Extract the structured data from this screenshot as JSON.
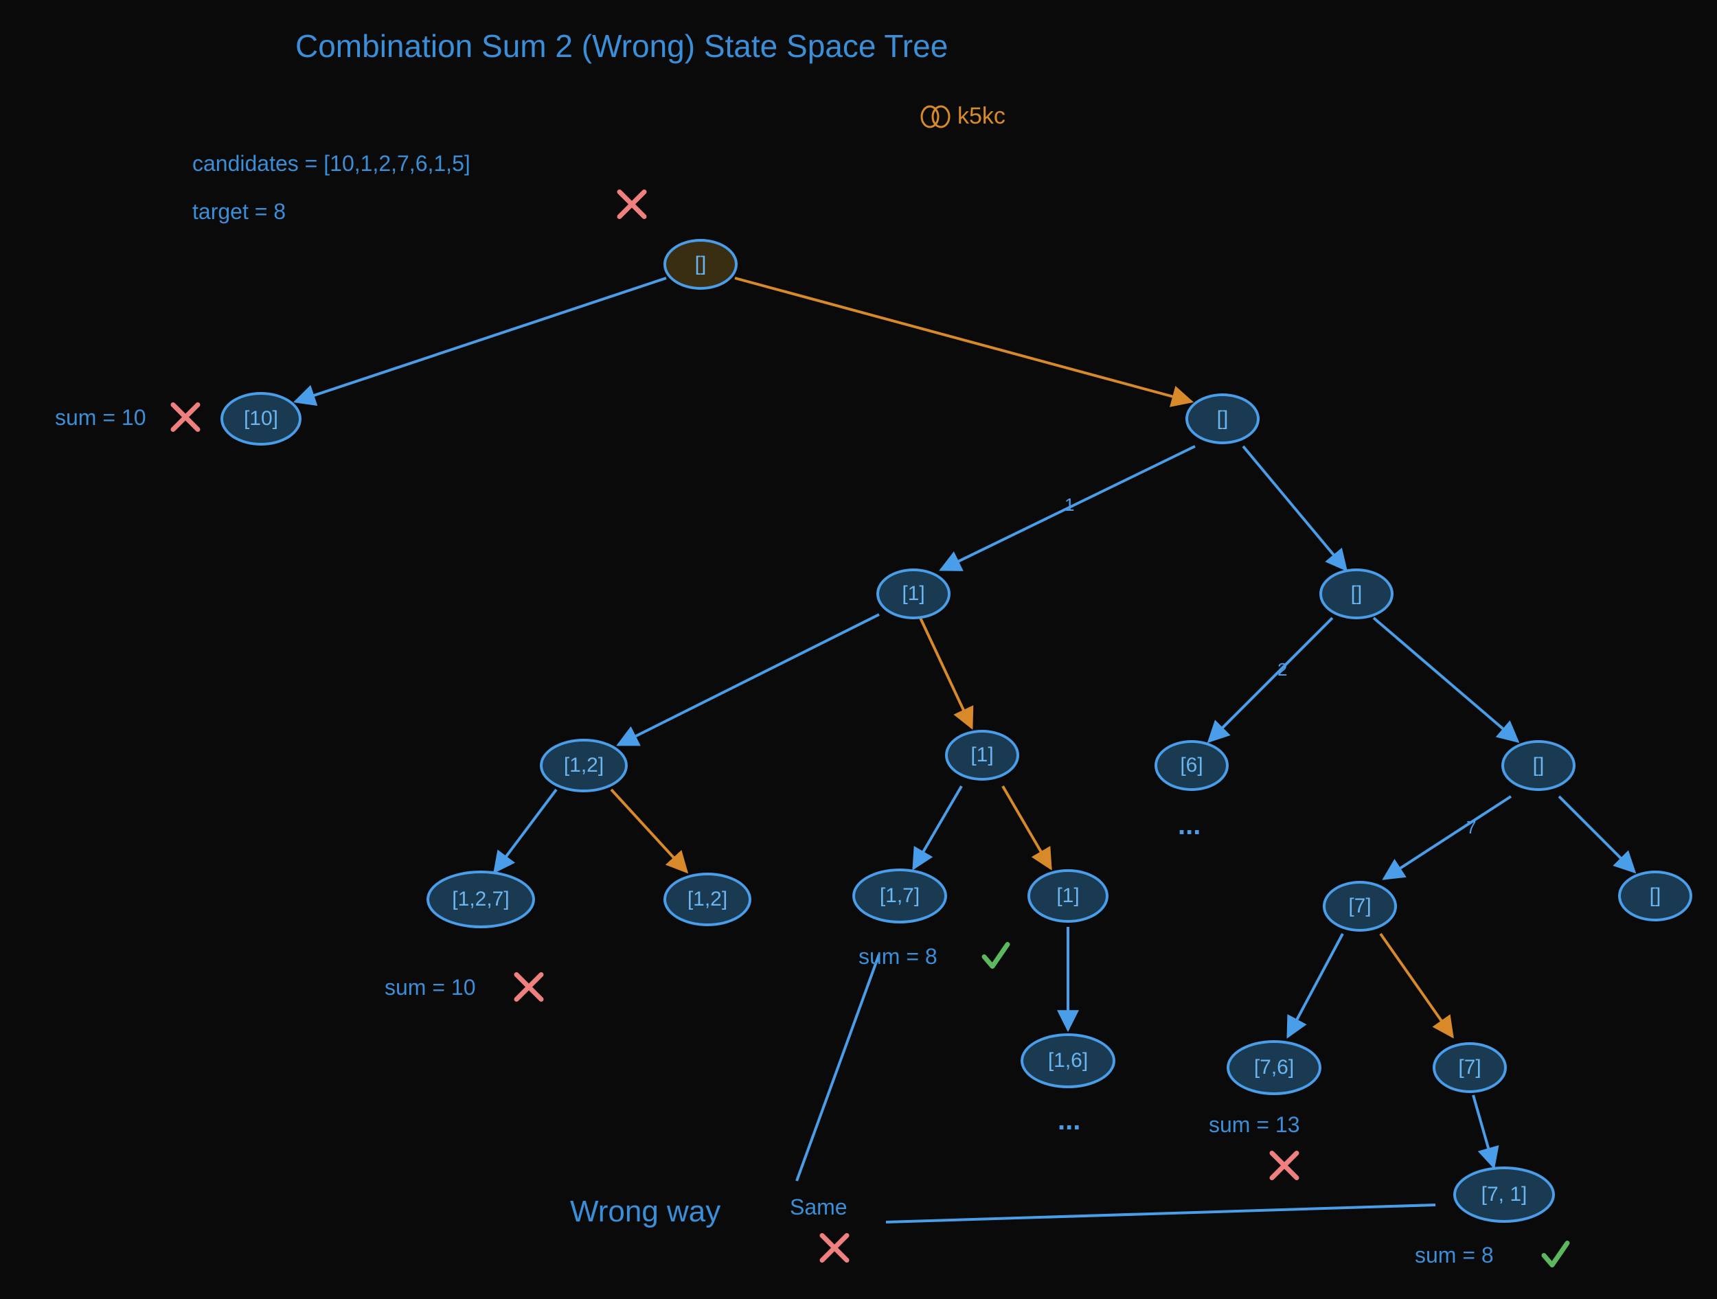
{
  "title": "Combination Sum 2 (Wrong) State Space Tree",
  "brand": "k5kc",
  "info": {
    "candidates": "candidates = [10,1,2,7,6,1,5]",
    "target": "target = 8"
  },
  "nodes": {
    "root": "[]",
    "n10": "[10]",
    "n_empty2": "[]",
    "n1": "[1]",
    "n_empty3": "[]",
    "n12": "[1,2]",
    "n1b": "[1]",
    "n6": "[6]",
    "n_empty4": "[]",
    "n127": "[1,2,7]",
    "n12b": "[1,2]",
    "n17": "[1,7]",
    "n1c": "[1]",
    "n7": "[7]",
    "n_empty5": "[]",
    "n16": "[1,6]",
    "n76": "[7,6]",
    "n7b": "[7]",
    "n71": "[7, 1]"
  },
  "annotations": {
    "sum10a": "sum = 10",
    "sum10b": "sum = 10",
    "sum8a": "sum = 8",
    "sum13": "sum = 13",
    "sum8b": "sum = 8",
    "wrongway": "Wrong way",
    "same": "Same"
  },
  "edge_labels": {
    "e1": "1",
    "e2": "2",
    "e7": "7"
  },
  "ellipsis": "...",
  "colors": {
    "blue": "#4a9de8",
    "orange": "#d88a2b",
    "red": "#f08080",
    "green": "#5cb85c",
    "bg": "#0a0a0a"
  }
}
